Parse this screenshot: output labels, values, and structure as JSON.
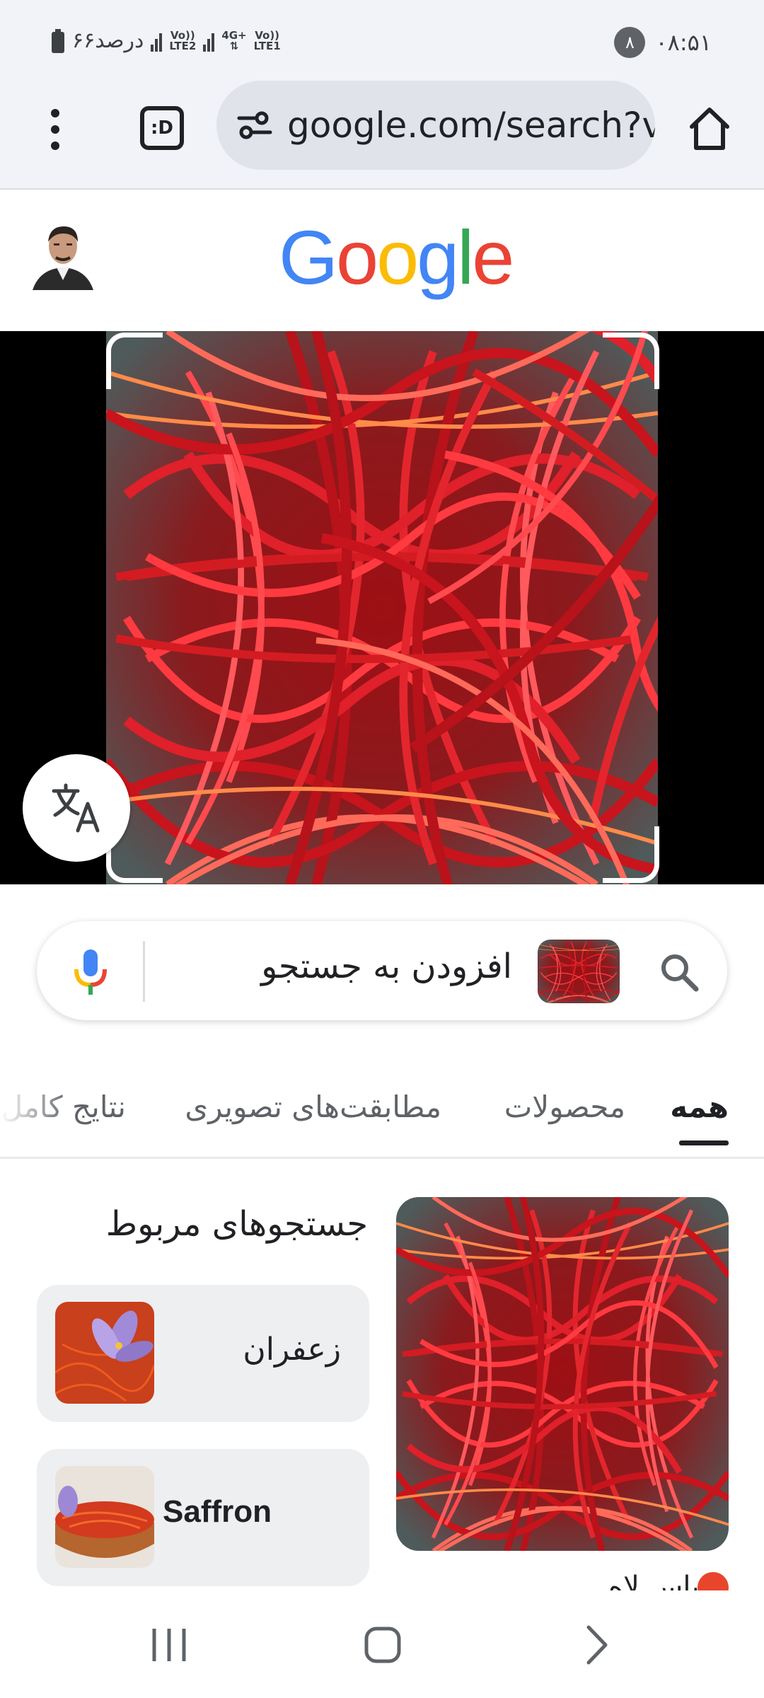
{
  "status_bar": {
    "time": "۰۸:۵۱",
    "notification_count": "۸",
    "battery_text": "۶۶درصد",
    "network_labels": [
      "Vo))\nLTE2",
      "4G+\nLTE1"
    ]
  },
  "browser": {
    "url": "google.com/search?v",
    "tab_switcher_label": ":D",
    "icons": [
      "home-icon",
      "tune-icon",
      "tab-switcher-icon",
      "more-vert-icon"
    ]
  },
  "google": {
    "logo_letters": [
      "G",
      "o",
      "o",
      "g",
      "l",
      "e"
    ],
    "logo_colors": [
      "#4285F4",
      "#EA4335",
      "#FBBC05",
      "#4285F4",
      "#34A853",
      "#EA4335"
    ]
  },
  "search": {
    "placeholder": "افزودن به جستجو"
  },
  "tabs": [
    {
      "label": "همه",
      "active": true
    },
    {
      "label": "محصولات",
      "active": false
    },
    {
      "label": "مطابقت‌های تصویری",
      "active": false
    },
    {
      "label": "نتایج کامل",
      "active": false
    }
  ],
  "results": {
    "related_title": "جستجوهای مربوط",
    "related": [
      {
        "label": "زعفران"
      },
      {
        "label": "Saffron"
      }
    ],
    "source_partial": "پاس لاه"
  },
  "colors": {
    "accent_red": "#c41e1e",
    "chip_bg": "#eeeff1"
  }
}
